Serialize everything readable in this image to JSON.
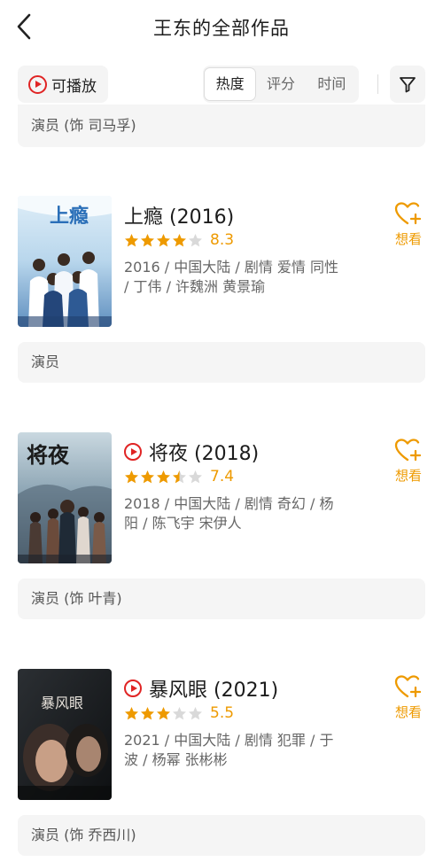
{
  "header": {
    "title": "王东的全部作品"
  },
  "toolbar": {
    "playable_label": "可播放",
    "sort_tabs": [
      {
        "label": "热度",
        "active": true
      },
      {
        "label": "评分",
        "active": false
      },
      {
        "label": "时间",
        "active": false
      }
    ]
  },
  "top_role": "演员 (饰 司马孚)",
  "works": [
    {
      "title": "上瘾 (2016)",
      "playable": false,
      "score": "8.3",
      "stars": 4,
      "meta": "2016 / 中国大陆 / 剧情 爱情 同性 / 丁伟 / 许魏洲 黄景瑜",
      "want_label": "想看",
      "role": "演员"
    },
    {
      "title": "将夜 (2018)",
      "playable": true,
      "score": "7.4",
      "stars": 3.5,
      "meta": "2018 / 中国大陆 / 剧情 奇幻 / 杨阳 / 陈飞宇 宋伊人",
      "want_label": "想看",
      "role": "演员 (饰 叶青)"
    },
    {
      "title": "暴风眼 (2021)",
      "playable": true,
      "score": "5.5",
      "stars": 3,
      "meta": "2021 / 中国大陆 / 剧情 犯罪 / 于波 / 杨幂 张彬彬",
      "want_label": "想看",
      "role": "演员 (饰 乔西川)"
    }
  ],
  "posters": [
    {
      "title_text": "上瘾"
    },
    {
      "title_text": "将夜"
    },
    {
      "title_text": "暴风眼"
    }
  ],
  "colors": {
    "accent": "#ee9a00",
    "play_red": "#e02424",
    "star_empty": "#d9d9d9",
    "bar_bg": "#f5f5f5"
  },
  "icons": {
    "back": "chevron-left-icon",
    "play": "play-circle-icon",
    "filter": "filter-funnel-icon",
    "want": "heart-plus-icon"
  }
}
